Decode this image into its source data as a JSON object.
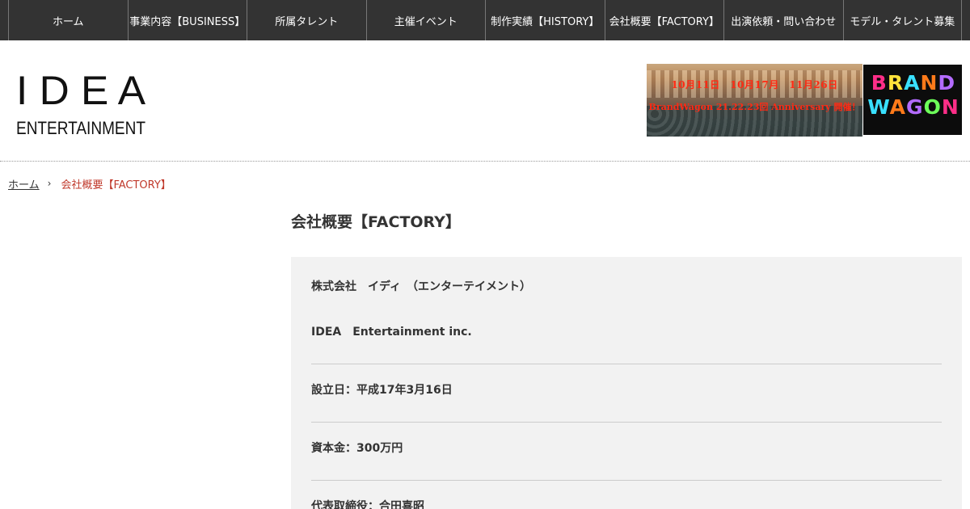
{
  "nav": {
    "items": [
      {
        "label": "ホーム"
      },
      {
        "label": "事業内容【BUSINESS】"
      },
      {
        "label": "所属タレント"
      },
      {
        "label": "主催イベント"
      },
      {
        "label": "制作実績【HISTORY】"
      },
      {
        "label": "会社概要【FACTORY】"
      },
      {
        "label": "出演依頼・問い合わせ"
      },
      {
        "label": "モデル・タレント募集"
      }
    ]
  },
  "logo": {
    "main": "I D E A",
    "sub": "ENTERTAINMENT"
  },
  "banner": {
    "dates": "10月11日　10月17月　11月26日",
    "subtitle": "BrandWagon 21.22.23回 Anniversary 開催！",
    "brand_line1": "BRAND",
    "brand_line2": "WAGON"
  },
  "breadcrumb": {
    "home": "ホーム",
    "separator": "›",
    "current": "会社概要【FACTORY】"
  },
  "page": {
    "title": "会社概要【FACTORY】"
  },
  "company": {
    "name_ja": "株式会社　イディ　（エンターテイメント）",
    "name_en": "IDEA　Entertainment inc.",
    "rows": [
      "設立日：平成17年3月16日",
      "資本金：300万円",
      "代表取締役：合田喜昭"
    ]
  },
  "colors": {
    "nav_bg": "#333333",
    "accent": "#c0392b",
    "content_bg": "#f2f2f2"
  }
}
